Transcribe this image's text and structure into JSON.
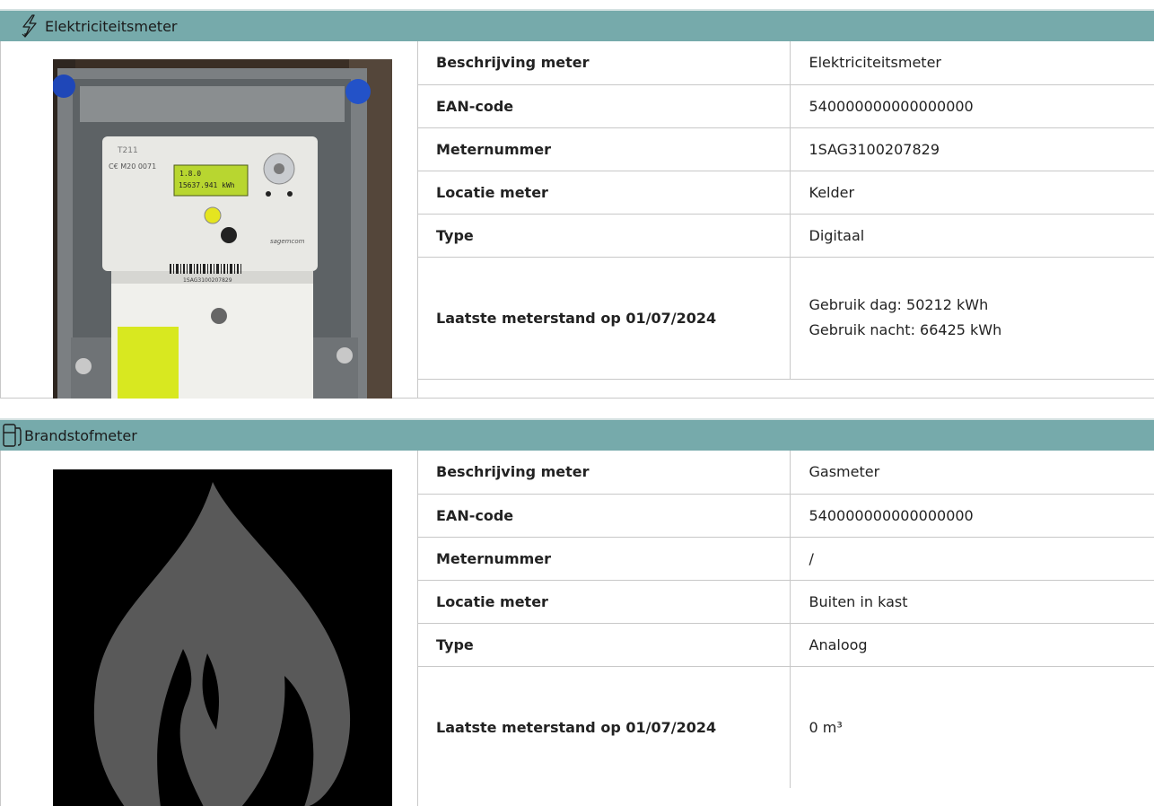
{
  "electricity": {
    "title": "Elektriciteitsmeter",
    "icon": "lightning-icon",
    "rows": [
      {
        "label": "Beschrijving meter",
        "value": "Elektriciteitsmeter"
      },
      {
        "label": "EAN-code",
        "value": "540000000000000000"
      },
      {
        "label": "Meternummer",
        "value": "1SAG3100207829"
      },
      {
        "label": "Locatie meter",
        "value": "Kelder"
      },
      {
        "label": "Type",
        "value": "Digitaal"
      }
    ],
    "reading": {
      "label": "Laatste meterstand op 01/07/2024",
      "day": "Gebruik dag: 50212 kWh",
      "night": "Gebruik nacht: 66425 kWh"
    },
    "photo": {
      "brand": "T211",
      "mark": "C€ M20 0071",
      "lcd_top": "1.8.0",
      "lcd_value": "15637.941 kWh",
      "serial": "1SAG3100207829",
      "logo": "sagemcom"
    }
  },
  "fuel": {
    "title": "Brandstofmeter",
    "icon": "fuel-pump-icon",
    "rows": [
      {
        "label": "Beschrijving meter",
        "value": "Gasmeter"
      },
      {
        "label": "EAN-code",
        "value": "540000000000000000"
      },
      {
        "label": "Meternummer",
        "value": "/"
      },
      {
        "label": "Locatie meter",
        "value": "Buiten in kast"
      },
      {
        "label": "Type",
        "value": "Analoog"
      }
    ],
    "reading": {
      "label": "Laatste meterstand op 01/07/2024",
      "value": "0 m³"
    }
  },
  "colors": {
    "header": "#76aaab",
    "border": "#c8c8c8",
    "flame": "#595959",
    "lcd": "#b8d630",
    "cover": "#d8e820"
  }
}
